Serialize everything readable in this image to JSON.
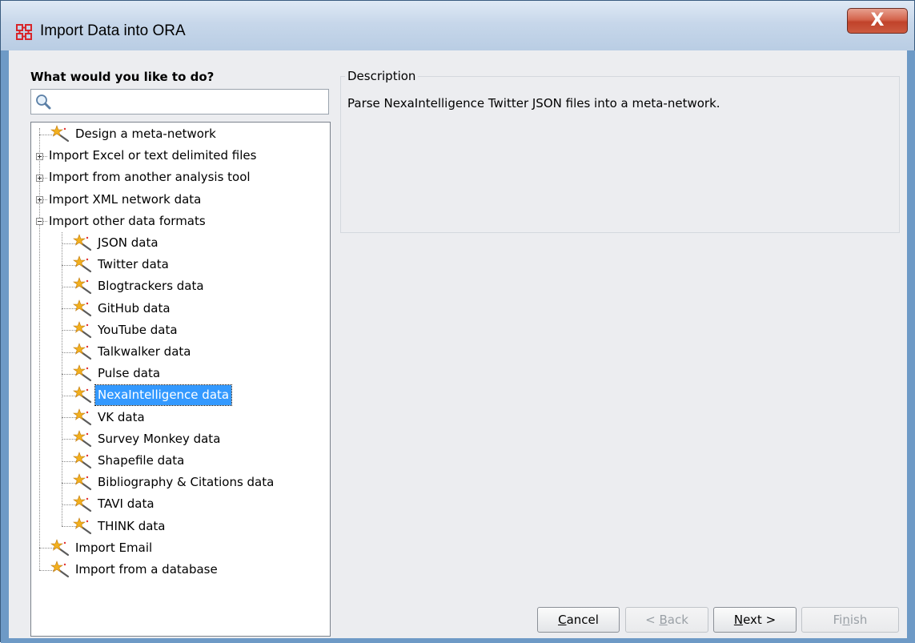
{
  "window": {
    "title": "Import Data into ORA",
    "close_label": "X"
  },
  "left_panel": {
    "prompt": "What would you like to do?",
    "search": {
      "value": "",
      "placeholder": ""
    }
  },
  "tree": {
    "items": [
      {
        "label": "Design a meta-network",
        "type": "leaf"
      },
      {
        "label": "Import Excel or text delimited files",
        "type": "collapsed"
      },
      {
        "label": "Import from another analysis tool",
        "type": "collapsed"
      },
      {
        "label": "Import XML network data",
        "type": "collapsed"
      },
      {
        "label": "Import other data formats",
        "type": "expanded",
        "children": [
          "JSON data",
          "Twitter data",
          "Blogtrackers data",
          "GitHub data",
          "YouTube data",
          "Talkwalker data",
          "Pulse data",
          "NexaIntelligence data",
          "VK data",
          "Survey Monkey data",
          "Shapefile data",
          "Bibliography & Citations data",
          "TAVI data",
          "THINK data"
        ]
      },
      {
        "label": "Import Email",
        "type": "leaf"
      },
      {
        "label": "Import from a database",
        "type": "leaf"
      }
    ],
    "selected": "NexaIntelligence data"
  },
  "description": {
    "legend": "Description",
    "text": "Parse NexaIntelligence Twitter JSON files into a meta-network."
  },
  "buttons": {
    "cancel": {
      "label": "Cancel",
      "mnemonic": "C",
      "enabled": true
    },
    "back": {
      "label": "< Back",
      "mnemonic": "B",
      "enabled": false
    },
    "next": {
      "label": "Next >",
      "mnemonic": "N",
      "enabled": true
    },
    "finish": {
      "label": "Finish",
      "mnemonic": "n",
      "enabled": false
    }
  },
  "colors": {
    "selection": "#3399ff",
    "title_bar": "#c7d7ea",
    "close_button": "#c0422a",
    "wand_star": "#f2b01e"
  }
}
